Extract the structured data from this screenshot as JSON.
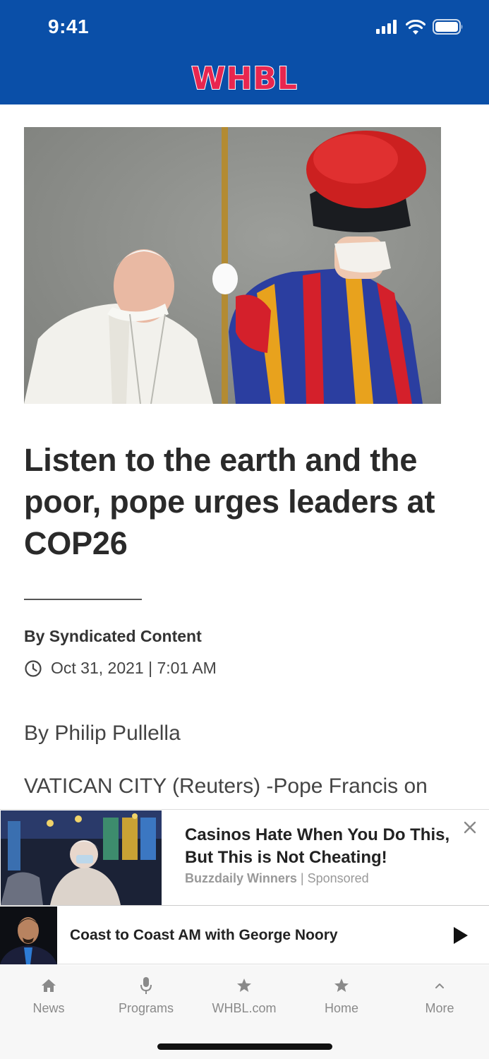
{
  "status_bar": {
    "time": "9:41"
  },
  "header": {
    "logo_text": "WHBL"
  },
  "article": {
    "headline": "Listen to the earth and the poor, pope urges leaders at COP26",
    "byline": "By Syndicated Content",
    "date": "Oct 31, 2021 | 7:01 AM",
    "paragraphs": [
      "By Philip Pullella",
      "VATICAN CITY (Reuters) -Pope Francis on"
    ]
  },
  "ad": {
    "title": "Casinos Hate When You Do This, But This is Not Cheating!",
    "source": "Buzzdaily Winners",
    "separator": " | ",
    "sponsored": "Sponsored"
  },
  "player": {
    "title": "Coast to Coast AM with George Noory"
  },
  "tabs": [
    {
      "label": "News",
      "icon": "home-icon"
    },
    {
      "label": "Programs",
      "icon": "microphone-icon"
    },
    {
      "label": "WHBL.com",
      "icon": "star-icon"
    },
    {
      "label": "Home",
      "icon": "star-icon"
    },
    {
      "label": "More",
      "icon": "chevron-up-icon"
    }
  ],
  "colors": {
    "header": "#0a4fa8",
    "logo": "#e8264f"
  }
}
